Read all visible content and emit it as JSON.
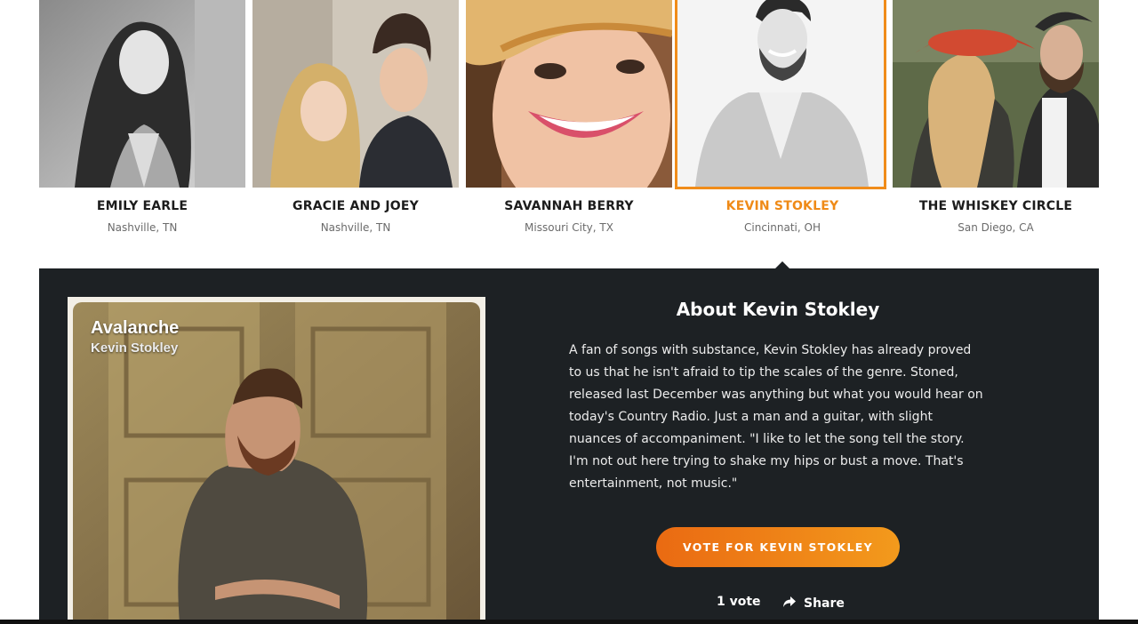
{
  "artists": [
    {
      "name": "EMILY EARLE",
      "location": "Nashville, TN"
    },
    {
      "name": "GRACIE AND JOEY",
      "location": "Nashville, TN"
    },
    {
      "name": "SAVANNAH BERRY",
      "location": "Missouri City, TX"
    },
    {
      "name": "KEVIN STOKLEY",
      "location": "Cincinnati, OH"
    },
    {
      "name": "THE WHISKEY CIRCLE",
      "location": "San Diego, CA"
    }
  ],
  "selected_index": 3,
  "detail": {
    "album_title": "Avalanche",
    "album_artist": "Kevin Stokley",
    "heading": "About Kevin Stokley",
    "bio": "A fan of songs with substance, Kevin Stokley has already proved to us that he isn't afraid to tip the scales of the genre. Stoned, released last December was anything but what you would hear on today's Country Radio. Just a man and a guitar, with slight nuances of accompaniment. \"I like to let the song tell the story. I'm not out here trying to shake my hips or bust a move. That's entertainment, not music.\"",
    "vote_label": "VOTE FOR KEVIN STOKLEY",
    "vote_count": "1 vote",
    "share_label": "Share"
  },
  "colors": {
    "accent": "#ef8a17",
    "panel": "#1d2124",
    "button_start": "#ea6a12",
    "button_end": "#f39a1c"
  },
  "icons": {
    "share": "share-arrow-icon"
  }
}
